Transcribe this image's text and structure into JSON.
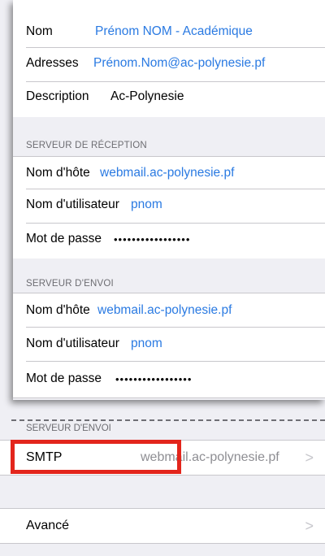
{
  "account": {
    "nom_label": "Nom",
    "nom_value": "Prénom NOM - Académique",
    "adresses_label": "Adresses",
    "adresses_value": "Prénom.Nom@ac-polynesie.pf",
    "description_label": "Description",
    "description_value": "Ac-Polynesie"
  },
  "reception": {
    "header": "SERVEUR DE RÉCEPTION",
    "hostname_label": "Nom d'hôte",
    "hostname_value": "webmail.ac-polynesie.pf",
    "username_label": "Nom d'utilisateur",
    "username_value": "pnom",
    "password_label": "Mot de passe",
    "password_value": "•••••••••••••••••"
  },
  "envoi": {
    "header": "SERVEUR D'ENVOI",
    "hostname_label": "Nom d'hôte",
    "hostname_value": "webmail.ac-polynesie.pf",
    "username_label": "Nom d'utilisateur",
    "username_value": "pnom",
    "password_label": "Mot de passe",
    "password_value": "•••••••••••••••••"
  },
  "outer": {
    "header": "SERVEUR D'ENVOI",
    "smtp_label": "SMTP",
    "smtp_value": "webmail.ac-polynesie.pf",
    "avance_label": "Avancé",
    "chevron": ">"
  },
  "colors": {
    "link_blue": "#2a7ae2",
    "highlight_red": "#e3251c",
    "background": "#efeff4"
  }
}
